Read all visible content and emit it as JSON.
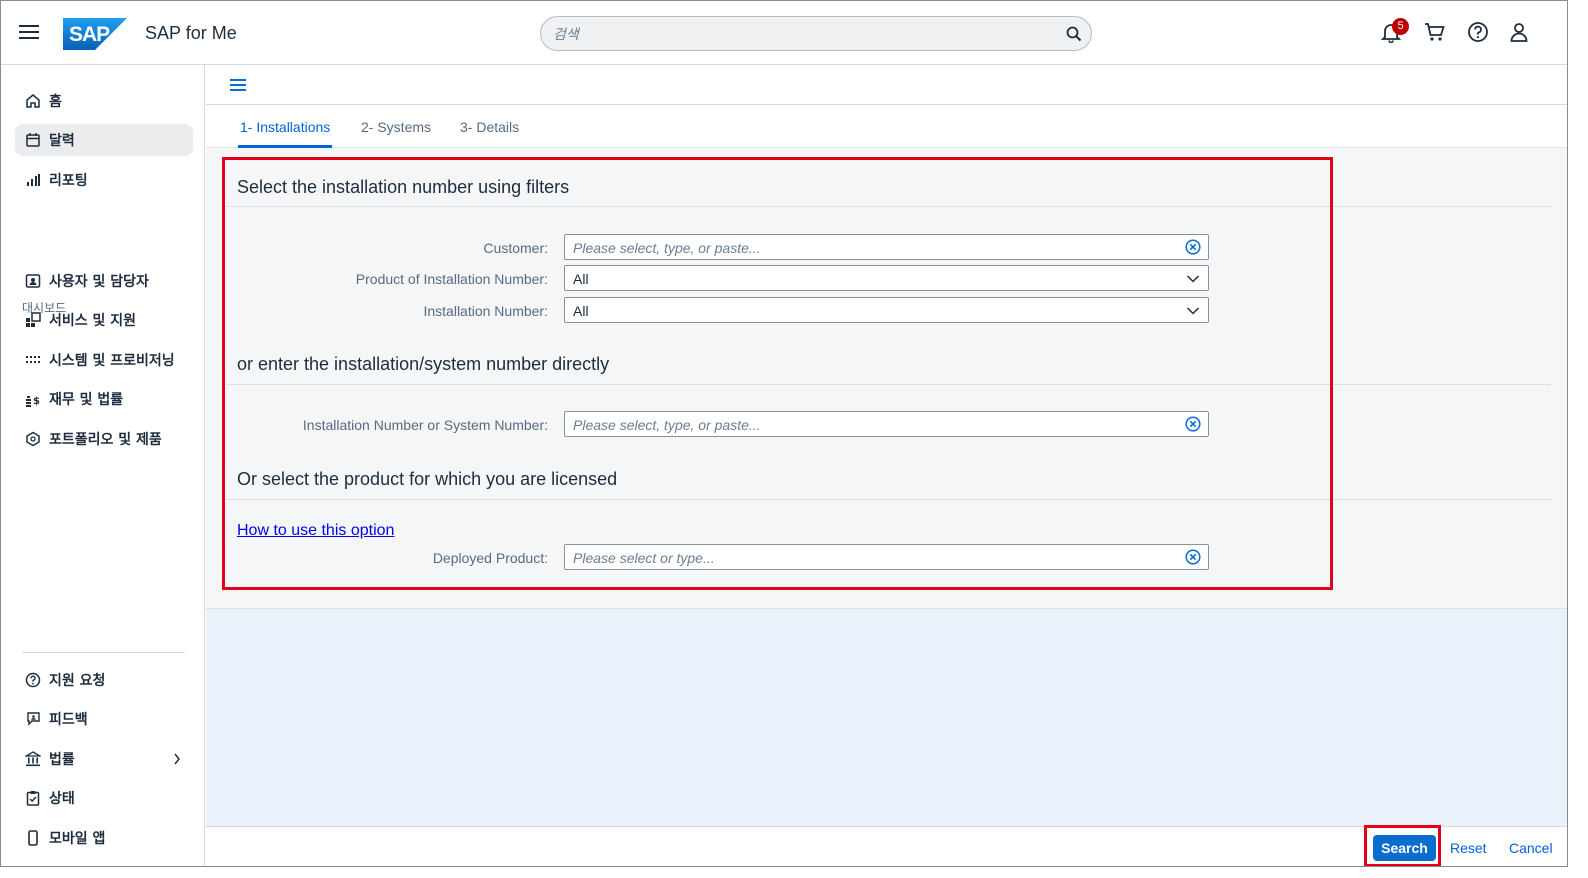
{
  "shell": {
    "app_title": "SAP for Me",
    "logo_text": "SAP",
    "search_placeholder": "검색",
    "notification_count": "5",
    "brand_color": "#0a6ed1",
    "icons": [
      "menu-icon",
      "search-icon",
      "bell-icon",
      "cart-icon",
      "help-icon",
      "user-icon"
    ]
  },
  "sidebar": {
    "items": [
      {
        "label": "홈",
        "icon": "home-icon"
      },
      {
        "label": "달력",
        "icon": "calendar-icon",
        "selected": true
      },
      {
        "label": "리포팅",
        "icon": "chart-icon"
      }
    ],
    "section_label": "대시보드",
    "dashboard_items": [
      {
        "label": "사용자 및 담당자",
        "icon": "contacts-icon"
      },
      {
        "label": "서비스 및 지원",
        "icon": "services-icon"
      },
      {
        "label": "시스템 및 프로비저닝",
        "icon": "systems-icon"
      },
      {
        "label": "재무 및 법률",
        "icon": "finance-icon"
      },
      {
        "label": "포트폴리오 및 제품",
        "icon": "portfolio-icon"
      }
    ],
    "bottom_items": [
      {
        "label": "지원 요청",
        "icon": "question-icon"
      },
      {
        "label": "피드백",
        "icon": "feedback-icon"
      },
      {
        "label": "법률",
        "icon": "bank-icon"
      },
      {
        "label": "상태",
        "icon": "clipboard-icon"
      },
      {
        "label": "모바일 앱",
        "icon": "mobile-icon"
      }
    ]
  },
  "tabs": [
    {
      "label": "1- Installations",
      "active": true
    },
    {
      "label": "2- Systems"
    },
    {
      "label": "3- Details"
    }
  ],
  "form": {
    "section1_title": "Select the installation number using filters",
    "customer_label": "Customer:",
    "customer_placeholder": "Please select, type, or paste...",
    "product_label": "Product of Installation Number:",
    "product_value": "All",
    "installation_label": "Installation Number:",
    "installation_value": "All",
    "section2_title": "or enter the installation/system number directly",
    "direct_label": "Installation Number or System Number:",
    "direct_placeholder": "Please select, type, or paste...",
    "section3_title": "Or select the product for which you are licensed",
    "howto_link": "How to use this option",
    "deployed_label": "Deployed Product:",
    "deployed_placeholder": "Please select or type...",
    "highlight_color": "#e3001b"
  },
  "footer": {
    "search_label": "Search",
    "reset_label": "Reset",
    "cancel_label": "Cancel"
  }
}
